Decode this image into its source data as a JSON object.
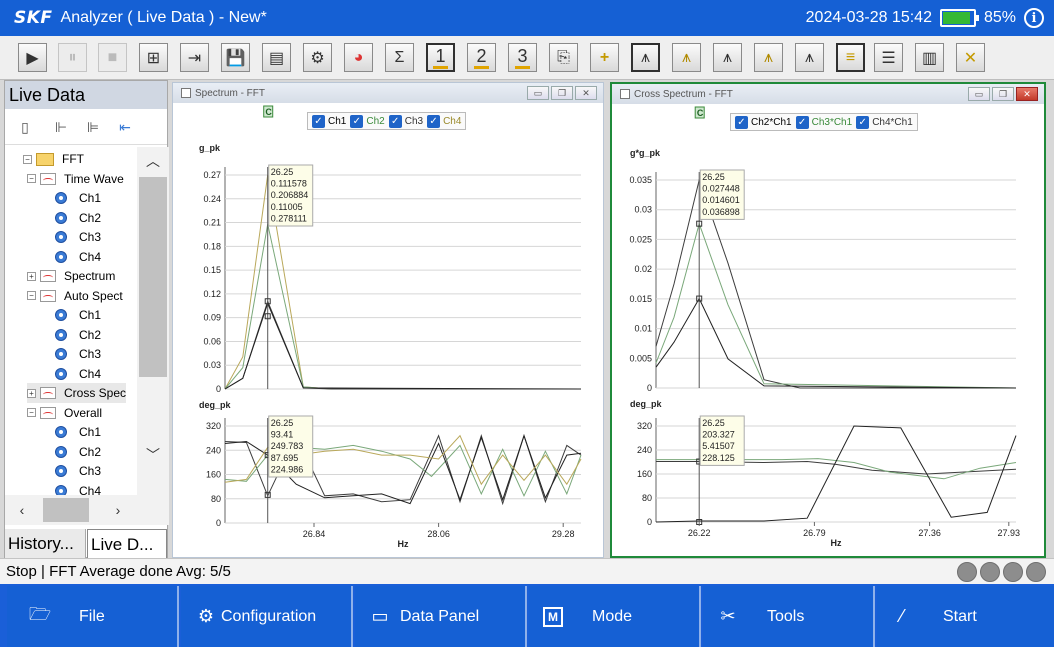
{
  "titlebar": {
    "logo": "SKF",
    "title": "Analyzer ( Live Data ) - New*",
    "datetime": "2024-03-28 15:42",
    "battery_percent": 85,
    "battery_label": "85%",
    "info_icon": "i"
  },
  "toolbar": {
    "buttons": [
      {
        "name": "play-button",
        "icon": "▶"
      },
      {
        "name": "pause-button",
        "icon": "⏸"
      },
      {
        "name": "stop-button",
        "icon": "■"
      },
      {
        "name": "new-folder-button",
        "icon": "⊞"
      },
      {
        "name": "open-folder-button",
        "icon": "⇥"
      },
      {
        "name": "save-button",
        "icon": "💾"
      },
      {
        "name": "report-button",
        "icon": "▤"
      },
      {
        "name": "settings-button",
        "icon": "⚙"
      },
      {
        "name": "color-button",
        "icon": "◕"
      },
      {
        "name": "sum-button",
        "icon": "Σ"
      },
      {
        "name": "layout-1-button",
        "label": "1"
      },
      {
        "name": "layout-2-button",
        "label": "2"
      },
      {
        "name": "layout-3-button",
        "label": "3"
      },
      {
        "name": "export-button",
        "icon": "⎘"
      },
      {
        "name": "add-cursor-button",
        "icon": "+"
      },
      {
        "name": "spectrum-view-button",
        "icon": "⩚"
      },
      {
        "name": "waterfall-view-button",
        "icon": "⩚"
      },
      {
        "name": "harmonic-view-button",
        "icon": "⩚"
      },
      {
        "name": "sideband-view-button",
        "icon": "⩚"
      },
      {
        "name": "peak-view-button",
        "icon": "⩚"
      },
      {
        "name": "list-view-button",
        "icon": "≡"
      },
      {
        "name": "horizontal-split-button",
        "icon": "☰"
      },
      {
        "name": "vertical-split-button",
        "icon": "▥"
      },
      {
        "name": "close-all-button",
        "icon": "✕"
      }
    ]
  },
  "left": {
    "title": "Live Data",
    "tree": [
      {
        "label": "FFT",
        "level": 0,
        "icon": "folder",
        "expander": "-"
      },
      {
        "label": "Time Wave",
        "level": 1,
        "icon": "wave",
        "expander": "-"
      },
      {
        "label": "Ch1",
        "level": 2,
        "icon": "ch"
      },
      {
        "label": "Ch2",
        "level": 2,
        "icon": "ch"
      },
      {
        "label": "Ch3",
        "level": 2,
        "icon": "ch"
      },
      {
        "label": "Ch4",
        "level": 2,
        "icon": "ch"
      },
      {
        "label": "Spectrum",
        "level": 1,
        "icon": "wave",
        "expander": "+"
      },
      {
        "label": "Auto Spect",
        "level": 1,
        "icon": "wave",
        "expander": "-"
      },
      {
        "label": "Ch1",
        "level": 2,
        "icon": "ch"
      },
      {
        "label": "Ch2",
        "level": 2,
        "icon": "ch"
      },
      {
        "label": "Ch3",
        "level": 2,
        "icon": "ch"
      },
      {
        "label": "Ch4",
        "level": 2,
        "icon": "ch"
      },
      {
        "label": "Cross Spec",
        "level": 1,
        "icon": "wave",
        "expander": "+",
        "selected": true
      },
      {
        "label": "Overall",
        "level": 1,
        "icon": "wave",
        "expander": "-"
      },
      {
        "label": "Ch1",
        "level": 2,
        "icon": "ch"
      },
      {
        "label": "Ch2",
        "level": 2,
        "icon": "ch"
      },
      {
        "label": "Ch3",
        "level": 2,
        "icon": "ch"
      },
      {
        "label": "Ch4",
        "level": 2,
        "icon": "ch"
      }
    ],
    "tabs": [
      "History...",
      "Live D..."
    ]
  },
  "win1": {
    "title": "Spectrum - FFT",
    "legend": [
      {
        "label": "Ch1",
        "color": "#000000"
      },
      {
        "label": "Ch2",
        "color": "#3a8a3a"
      },
      {
        "label": "Ch3",
        "color": "#333333"
      },
      {
        "label": "Ch4",
        "color": "#9a8a2a"
      }
    ],
    "cursor_tag": "C",
    "top": {
      "ylabel": "g_pk",
      "yticks": [
        "0.27",
        "0.24",
        "0.21",
        "0.18",
        "0.15",
        "0.12",
        "0.09",
        "0.06",
        "0.03",
        "0"
      ],
      "readout": [
        "26.25",
        "0.111578",
        "0.206884",
        "0.11005",
        "0.278111"
      ]
    },
    "bottom": {
      "ylabel": "deg_pk",
      "yticks": [
        "320",
        "240",
        "160",
        "80",
        "0"
      ],
      "readout": [
        "26.25",
        "93.41",
        "249.783",
        "87.695",
        "224.986"
      ]
    },
    "xticks": [
      "26.84",
      "28.06",
      "29.28"
    ],
    "xlabel": "Hz"
  },
  "win2": {
    "title": "Cross Spectrum - FFT",
    "legend": [
      {
        "label": "Ch2*Ch1",
        "color": "#000000"
      },
      {
        "label": "Ch3*Ch1",
        "color": "#3a8a3a"
      },
      {
        "label": "Ch4*Ch1",
        "color": "#333333"
      }
    ],
    "cursor_tag": "C",
    "top": {
      "ylabel": "g*g_pk",
      "yticks": [
        "0.035",
        "0.03",
        "0.025",
        "0.02",
        "0.015",
        "0.01",
        "0.005",
        "0"
      ],
      "readout": [
        "26.25",
        "0.027448",
        "0.014601",
        "0.036898"
      ]
    },
    "bottom": {
      "ylabel": "deg_pk",
      "yticks": [
        "320",
        "240",
        "160",
        "80",
        "0"
      ],
      "readout": [
        "26.25",
        "203.327",
        "5.41507",
        "228.125"
      ]
    },
    "xticks": [
      "26.22",
      "26.79",
      "27.36",
      "27.93"
    ],
    "xlabel": "Hz"
  },
  "status": {
    "text": "Stop  | FFT Average done Avg: 5/5"
  },
  "nav": [
    {
      "label": "File",
      "icon": "folder-icon",
      "glyph": "🗁"
    },
    {
      "label": "Configuration",
      "icon": "config-icon",
      "glyph": "⚙"
    },
    {
      "label": "Data Panel",
      "icon": "data-panel-icon",
      "glyph": "▭"
    },
    {
      "label": "Mode",
      "icon": "mode-icon",
      "glyph": "M"
    },
    {
      "label": "Tools",
      "icon": "tools-icon",
      "glyph": "✂"
    },
    {
      "label": "Start",
      "icon": "start-icon",
      "glyph": "⁄"
    }
  ]
}
